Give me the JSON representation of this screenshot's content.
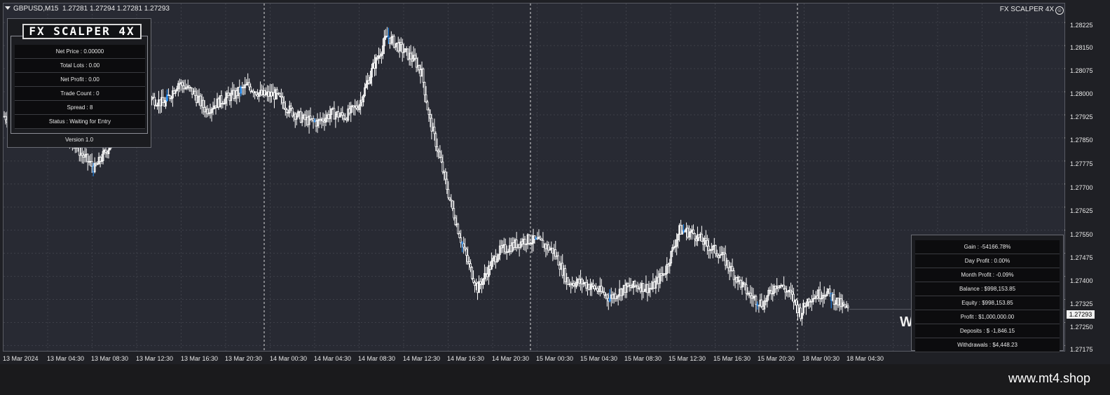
{
  "header": {
    "symbol": "GBPUSD,M15",
    "quote": "1.27281 1.27294 1.27281 1.27293",
    "ea_name": "FX SCALPER 4X",
    "ea_icon": "smiley-icon"
  },
  "info_panel": {
    "logo": "FX SCALPER 4X",
    "rows": [
      "Net Price : 0.00000",
      "Total Lots : 0.00",
      "Net Profit : 0.00",
      "Trade Count : 0",
      "Spread : 8",
      "Status : Waiting for Entry"
    ],
    "version": "Version 1.0"
  },
  "stats_panel": {
    "rows": [
      "Gain : -54166.78%",
      "Day Profit : 0.00%",
      "Month Profit : -0.09%",
      "Balance : $998,153.85",
      "Equity : $998,153.85",
      "Profit : $1,000,000.00",
      "Deposits : $ -1,846.15",
      "Withdrawals : $4,448.23"
    ]
  },
  "overlay_letter": "W",
  "price_axis": {
    "ticks": [
      "1.28225",
      "1.28150",
      "1.28075",
      "1.28000",
      "1.27925",
      "1.27850",
      "1.27775",
      "1.27700",
      "1.27625",
      "1.27550",
      "1.27475",
      "1.27400",
      "1.27325",
      "1.27250",
      "1.27175"
    ],
    "current": "1.27293"
  },
  "time_axis": {
    "ticks": [
      "13 Mar 2024",
      "13 Mar 04:30",
      "13 Mar 08:30",
      "13 Mar 12:30",
      "13 Mar 16:30",
      "13 Mar 20:30",
      "14 Mar 00:30",
      "14 Mar 04:30",
      "14 Mar 08:30",
      "14 Mar 12:30",
      "14 Mar 16:30",
      "14 Mar 20:30",
      "15 Mar 00:30",
      "15 Mar 04:30",
      "15 Mar 08:30",
      "15 Mar 12:30",
      "15 Mar 16:30",
      "15 Mar 20:30",
      "18 Mar 00:30",
      "18 Mar 04:30"
    ]
  },
  "footer": {
    "brand": "www.mt4.shop"
  },
  "colors": {
    "background": "#282a33",
    "candle": "#ffffff",
    "grid": "#3e4049",
    "accent_candle": "#1e90ff"
  },
  "chart_data": {
    "type": "candlestick",
    "symbol": "GBPUSD",
    "timeframe": "M15",
    "ylim": [
      1.2716,
      1.2828
    ],
    "price_path": [
      [
        0,
        1.2792
      ],
      [
        10,
        1.279
      ],
      [
        25,
        1.2795
      ],
      [
        40,
        1.279
      ],
      [
        55,
        1.278
      ],
      [
        65,
        1.2775
      ],
      [
        75,
        1.2782
      ],
      [
        85,
        1.28
      ],
      [
        95,
        1.2805
      ],
      [
        105,
        1.2798
      ],
      [
        115,
        1.2796
      ],
      [
        125,
        1.2803
      ],
      [
        135,
        1.28
      ],
      [
        145,
        1.2794
      ],
      [
        155,
        1.2797
      ],
      [
        165,
        1.2799
      ],
      [
        175,
        1.2802
      ],
      [
        185,
        1.2799
      ],
      [
        195,
        1.2799
      ],
      [
        205,
        1.2794
      ],
      [
        215,
        1.2791
      ],
      [
        225,
        1.279
      ],
      [
        235,
        1.2793
      ],
      [
        245,
        1.2792
      ],
      [
        255,
        1.2796
      ],
      [
        265,
        1.2808
      ],
      [
        275,
        1.2818
      ],
      [
        285,
        1.2814
      ],
      [
        295,
        1.281
      ],
      [
        300,
        1.2806
      ],
      [
        305,
        1.2792
      ],
      [
        312,
        1.278
      ],
      [
        320,
        1.2765
      ],
      [
        328,
        1.2752
      ],
      [
        335,
        1.2742
      ],
      [
        340,
        1.2736
      ],
      [
        345,
        1.274
      ],
      [
        355,
        1.2748
      ],
      [
        365,
        1.275
      ],
      [
        375,
        1.2752
      ],
      [
        385,
        1.2751
      ],
      [
        395,
        1.2748
      ],
      [
        405,
        1.2738
      ],
      [
        415,
        1.2738
      ],
      [
        425,
        1.2736
      ],
      [
        435,
        1.2733
      ],
      [
        445,
        1.2736
      ],
      [
        455,
        1.2737
      ],
      [
        465,
        1.2736
      ],
      [
        475,
        1.2742
      ],
      [
        485,
        1.2755
      ],
      [
        495,
        1.2754
      ],
      [
        505,
        1.275
      ],
      [
        515,
        1.2747
      ],
      [
        525,
        1.274
      ],
      [
        535,
        1.2734
      ],
      [
        545,
        1.2731
      ],
      [
        555,
        1.2738
      ],
      [
        565,
        1.2734
      ],
      [
        572,
        1.2728
      ],
      [
        578,
        1.2733
      ],
      [
        590,
        1.2735
      ],
      [
        600,
        1.2731
      ],
      [
        606,
        1.2729
      ]
    ],
    "x_max": 760
  }
}
